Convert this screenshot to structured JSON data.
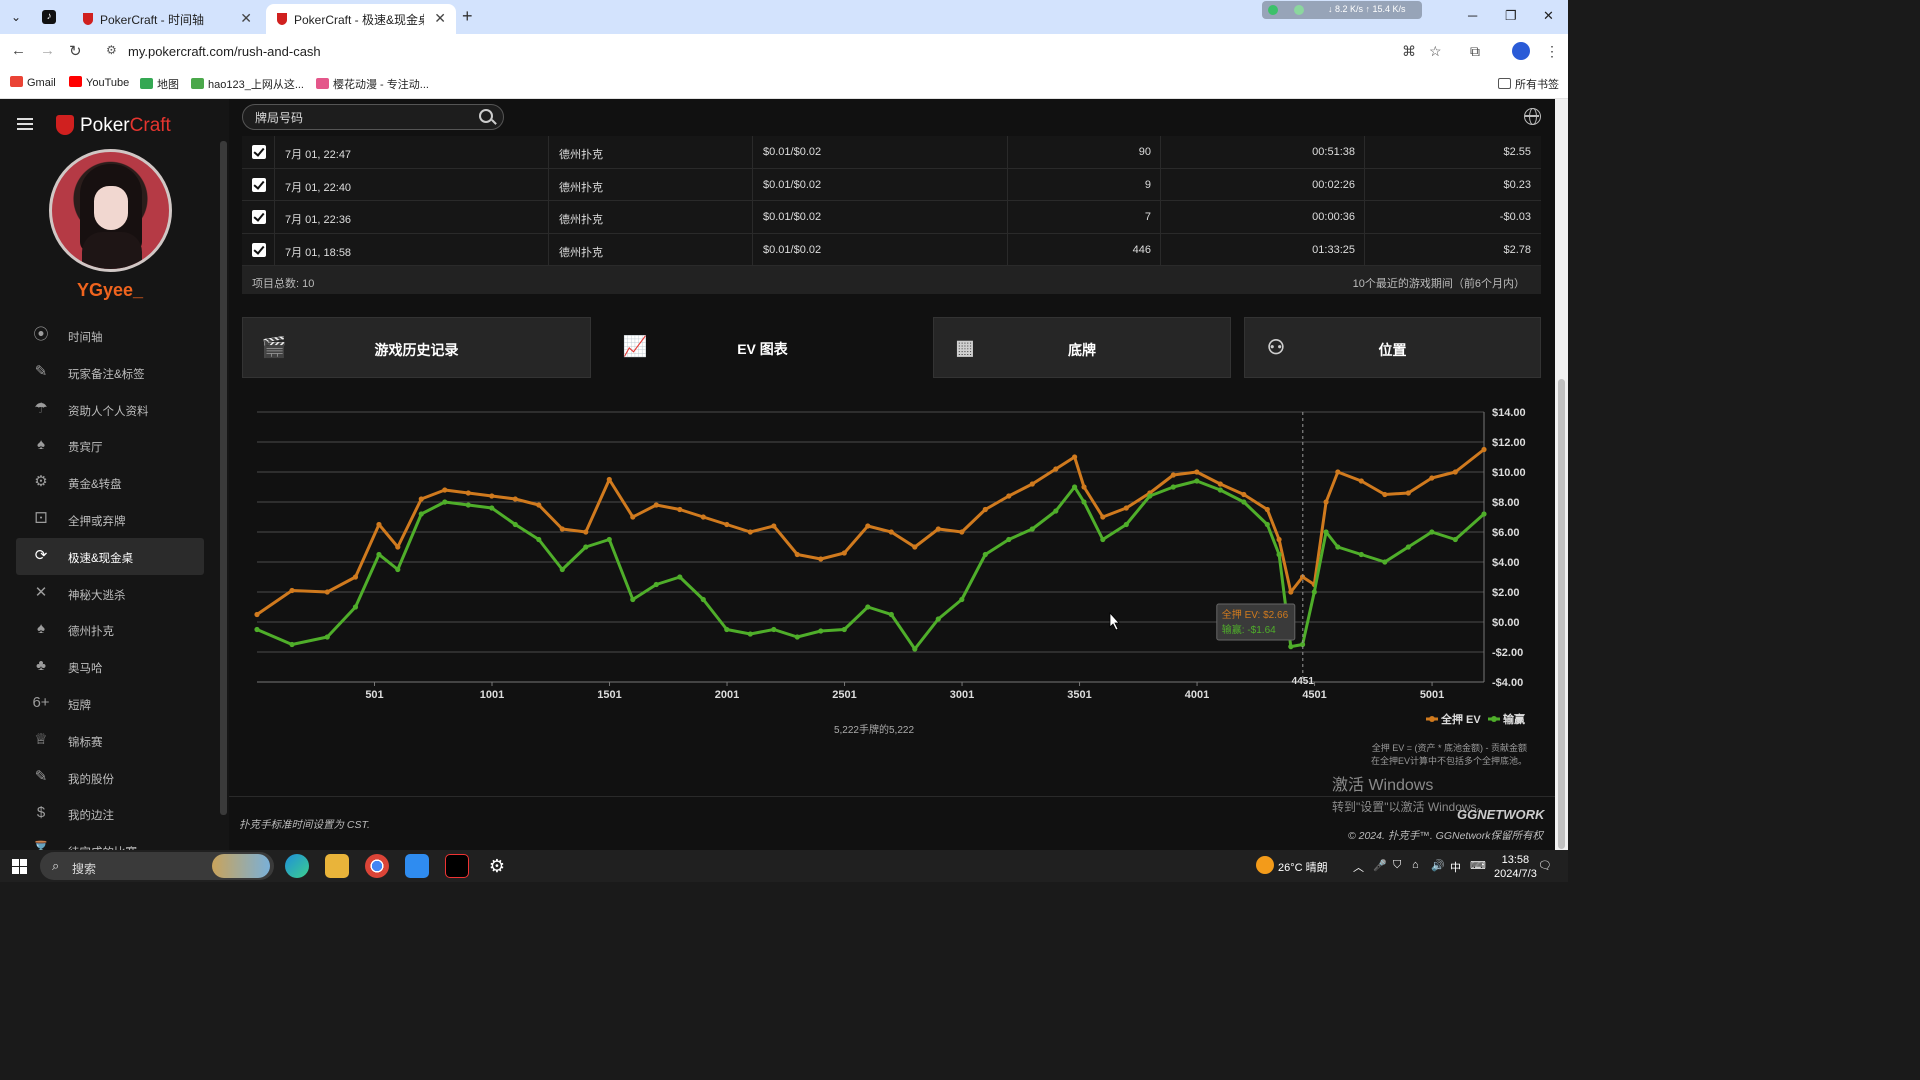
{
  "browser": {
    "tabs": [
      {
        "title": "PokerCraft - 时间轴",
        "active": false
      },
      {
        "title": "PokerCraft - 极速&现金桌",
        "active": true
      }
    ],
    "url": "my.pokercraft.com/rush-and-cash",
    "net_monitor": "↓ 8.2 K/s ↑ 15.4 K/s",
    "bookmarks": [
      "Gmail",
      "YouTube",
      "地图",
      "hao123_上网从这...",
      "樱花动漫 - 专注动..."
    ],
    "all_bookmarks": "所有书签"
  },
  "sidebar": {
    "brand_a": "Poker",
    "brand_b": "Craft",
    "username": "YGyee_",
    "items": [
      {
        "label": "时间轴",
        "icon": "timeline-icon",
        "glyph": "⦿"
      },
      {
        "label": "玩家备注&标签",
        "icon": "notes-edit-icon",
        "glyph": "✎"
      },
      {
        "label": "资助人个人资料",
        "icon": "sponsor-icon",
        "glyph": "☂"
      },
      {
        "label": "贵宾厅",
        "icon": "vip-cards-icon",
        "glyph": "♠"
      },
      {
        "label": "黄金&转盘",
        "icon": "wheel-icon",
        "glyph": "⚙"
      },
      {
        "label": "全押或弃牌",
        "icon": "allin-fold-icon",
        "glyph": "⚀"
      },
      {
        "label": "极速&现金桌",
        "icon": "rush-cash-icon",
        "glyph": "⟳",
        "active": true
      },
      {
        "label": "神秘大逃杀",
        "icon": "mystery-battle-icon",
        "glyph": "✕"
      },
      {
        "label": "德州扑克",
        "icon": "holdem-cards-icon",
        "glyph": "♠"
      },
      {
        "label": "奥马哈",
        "icon": "omaha-cards-icon",
        "glyph": "♣"
      },
      {
        "label": "短牌",
        "icon": "short-deck-icon",
        "glyph": "6+"
      },
      {
        "label": "锦标赛",
        "icon": "trophy-icon",
        "glyph": "♕"
      },
      {
        "label": "我的股份",
        "icon": "shares-icon",
        "glyph": "✎"
      },
      {
        "label": "我的边注",
        "icon": "side-bet-icon",
        "glyph": "$"
      },
      {
        "label": "待完成的比赛",
        "icon": "pending-icon",
        "glyph": "⌛"
      }
    ]
  },
  "search": {
    "placeholder": "牌局号码"
  },
  "table": {
    "rows": [
      {
        "date": "7月 01, 22:47",
        "game": "德州扑克",
        "stakes": "$0.01/$0.02",
        "hands": "90",
        "duration": "00:51:38",
        "result": "$2.55"
      },
      {
        "date": "7月 01, 22:40",
        "game": "德州扑克",
        "stakes": "$0.01/$0.02",
        "hands": "9",
        "duration": "00:02:26",
        "result": "$0.23"
      },
      {
        "date": "7月 01, 22:36",
        "game": "德州扑克",
        "stakes": "$0.01/$0.02",
        "hands": "7",
        "duration": "00:00:36",
        "result": "-$0.03"
      },
      {
        "date": "7月 01, 18:58",
        "game": "德州扑克",
        "stakes": "$0.01/$0.02",
        "hands": "446",
        "duration": "01:33:25",
        "result": "$2.78"
      }
    ],
    "total": "项目总数: 10",
    "period": "10个最近的游戏期间（前6个月内）"
  },
  "view_tabs": [
    {
      "label": "游戏历史记录",
      "icon": "history-icon",
      "glyph": "🎬"
    },
    {
      "label": "EV 图表",
      "icon": "line-chart-icon",
      "glyph": "📈",
      "active": true
    },
    {
      "label": "底牌",
      "icon": "grid-icon",
      "glyph": "▦"
    },
    {
      "label": "位置",
      "icon": "position-icon",
      "glyph": "⚇"
    }
  ],
  "chart_data": {
    "type": "line",
    "x_ticks": [
      "501",
      "1001",
      "1501",
      "2001",
      "2501",
      "3001",
      "3501",
      "4001",
      "4501",
      "5001"
    ],
    "y_ticks": [
      "$14.00",
      "$12.00",
      "$10.00",
      "$8.00",
      "$6.00",
      "$4.00",
      "$2.00",
      "$0.00",
      "-$2.00",
      "-$4.00"
    ],
    "xlim": [
      1,
      5222
    ],
    "ylim": [
      -4,
      14
    ],
    "colors": {
      "allin_ev": "#d07a1e",
      "winnings": "#4fae2a"
    },
    "series": [
      {
        "name": "全押 EV",
        "x": [
          1,
          150,
          300,
          420,
          520,
          600,
          700,
          800,
          900,
          1000,
          1100,
          1200,
          1300,
          1400,
          1500,
          1600,
          1700,
          1800,
          1900,
          2000,
          2100,
          2200,
          2300,
          2400,
          2500,
          2600,
          2700,
          2800,
          2900,
          3000,
          3100,
          3200,
          3300,
          3400,
          3480,
          3520,
          3600,
          3700,
          3800,
          3900,
          4000,
          4100,
          4200,
          4300,
          4350,
          4400,
          4450,
          4500,
          4550,
          4600,
          4700,
          4800,
          4900,
          5000,
          5100,
          5222
        ],
        "y": [
          0.5,
          2.1,
          2.0,
          3.0,
          6.5,
          5.0,
          8.2,
          8.8,
          8.6,
          8.4,
          8.2,
          7.8,
          6.2,
          6.0,
          9.5,
          7.0,
          7.8,
          7.5,
          7.0,
          6.5,
          6.0,
          6.4,
          4.5,
          4.2,
          4.6,
          6.4,
          6.0,
          5.0,
          6.2,
          6.0,
          7.5,
          8.4,
          9.2,
          10.2,
          11.0,
          9.0,
          7.0,
          7.6,
          8.6,
          9.8,
          10.0,
          9.2,
          8.5,
          7.5,
          5.5,
          2.0,
          3.0,
          2.5,
          8.0,
          10.0,
          9.4,
          8.5,
          8.6,
          9.6,
          10.0,
          11.5
        ]
      },
      {
        "name": "输赢",
        "x": [
          1,
          150,
          300,
          420,
          520,
          600,
          700,
          800,
          900,
          1000,
          1100,
          1200,
          1300,
          1400,
          1500,
          1600,
          1700,
          1800,
          1900,
          2000,
          2100,
          2200,
          2300,
          2400,
          2500,
          2600,
          2700,
          2800,
          2900,
          3000,
          3100,
          3200,
          3300,
          3400,
          3480,
          3520,
          3600,
          3700,
          3800,
          3900,
          4000,
          4100,
          4200,
          4300,
          4350,
          4400,
          4450,
          4500,
          4550,
          4600,
          4700,
          4800,
          4900,
          5000,
          5100,
          5222
        ],
        "y": [
          -0.5,
          -1.5,
          -1.0,
          1.0,
          4.5,
          3.5,
          7.2,
          8.0,
          7.8,
          7.6,
          6.5,
          5.5,
          3.5,
          5.0,
          5.5,
          1.5,
          2.5,
          3.0,
          1.5,
          -0.5,
          -0.8,
          -0.5,
          -1.0,
          -0.6,
          -0.5,
          1.0,
          0.5,
          -1.8,
          0.2,
          1.5,
          4.5,
          5.5,
          6.2,
          7.4,
          9.0,
          8.0,
          5.5,
          6.5,
          8.4,
          9.0,
          9.4,
          8.8,
          8.0,
          6.5,
          4.5,
          -1.64,
          -1.5,
          2.0,
          6.0,
          5.0,
          4.5,
          4.0,
          5.0,
          6.0,
          5.5,
          7.2
        ]
      }
    ],
    "crosshair": {
      "x": 4451,
      "label": "4451"
    },
    "tooltip": {
      "ev": "全押 EV: $2.66",
      "win": "输赢: -$1.64"
    },
    "legend": "bottom-right",
    "hands_caption": "5,222手牌的5,222",
    "footnote_1": "全押 EV = (资产 * 底池金额) - 贡献金额",
    "footnote_2": "在全押EV计算中不包括多个全押底池。"
  },
  "footer": {
    "timezone_note": "扑克手标准时间设置为 CST.",
    "copyright": "© 2024. 扑克手™. GGNetwork保留所有权",
    "gg_logo": "GGNETWORK"
  },
  "windows_activation": {
    "title": "激活 Windows",
    "subtitle": "转到\"设置\"以激活 Windows。"
  },
  "taskbar": {
    "search_label": "搜索",
    "weather": "26°C 晴朗",
    "time": "13:58",
    "date": "2024/7/3",
    "ime": "中"
  }
}
